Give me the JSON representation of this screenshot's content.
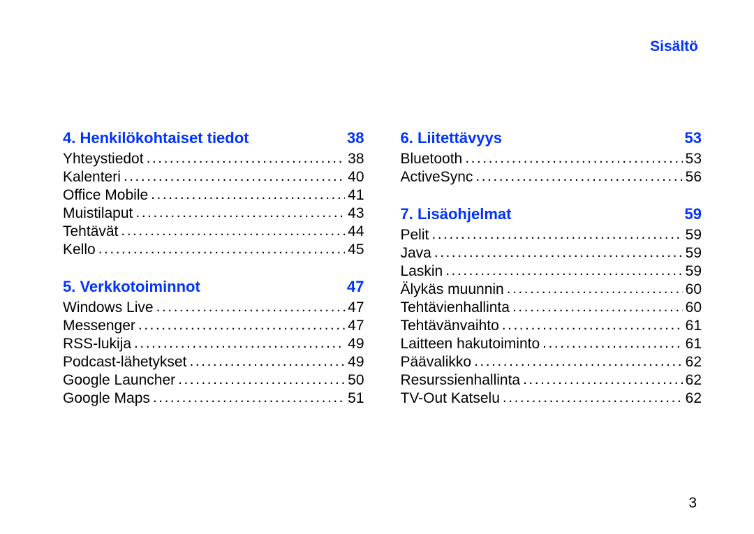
{
  "running_head": "Sisältö",
  "page_number": "3",
  "left": [
    {
      "kind": "section",
      "label": "4.  Henkilökohtaiset tiedot",
      "page": "38",
      "spacer": false
    },
    {
      "kind": "entry",
      "label": "Yhteystiedot",
      "page": "38"
    },
    {
      "kind": "entry",
      "label": "Kalenteri",
      "page": "40"
    },
    {
      "kind": "entry",
      "label": "Office Mobile",
      "page": "41"
    },
    {
      "kind": "entry",
      "label": "Muistilaput",
      "page": "43"
    },
    {
      "kind": "entry",
      "label": "Tehtävät",
      "page": "44"
    },
    {
      "kind": "entry",
      "label": "Kello",
      "page": "45"
    },
    {
      "kind": "section",
      "label": "5.  Verkkotoiminnot",
      "page": "47",
      "spacer": true
    },
    {
      "kind": "entry",
      "label": "Windows Live",
      "page": "47"
    },
    {
      "kind": "entry",
      "label": "Messenger",
      "page": "47"
    },
    {
      "kind": "entry",
      "label": "RSS-lukija",
      "page": "49"
    },
    {
      "kind": "entry",
      "label": "Podcast-lähetykset",
      "page": "49"
    },
    {
      "kind": "entry",
      "label": "Google Launcher",
      "page": "50"
    },
    {
      "kind": "entry",
      "label": "Google Maps",
      "page": "51"
    }
  ],
  "right": [
    {
      "kind": "section",
      "label": "6.  Liitettävyys",
      "page": "53",
      "spacer": false
    },
    {
      "kind": "entry",
      "label": "Bluetooth",
      "page": "53"
    },
    {
      "kind": "entry",
      "label": "ActiveSync",
      "page": "56"
    },
    {
      "kind": "section",
      "label": "7.  Lisäohjelmat",
      "page": "59",
      "spacer": true
    },
    {
      "kind": "entry",
      "label": "Pelit",
      "page": "59"
    },
    {
      "kind": "entry",
      "label": "Java",
      "page": "59"
    },
    {
      "kind": "entry",
      "label": "Laskin",
      "page": "59"
    },
    {
      "kind": "entry",
      "label": "Älykäs muunnin",
      "page": "60"
    },
    {
      "kind": "entry",
      "label": "Tehtävienhallinta",
      "page": "60"
    },
    {
      "kind": "entry",
      "label": "Tehtävänvaihto",
      "page": "61"
    },
    {
      "kind": "entry",
      "label": "Laitteen hakutoiminto",
      "page": "61"
    },
    {
      "kind": "entry",
      "label": "Päävalikko",
      "page": "62"
    },
    {
      "kind": "entry",
      "label": "Resurssienhallinta",
      "page": "62"
    },
    {
      "kind": "entry",
      "label": "TV-Out Katselu",
      "page": "62"
    }
  ]
}
